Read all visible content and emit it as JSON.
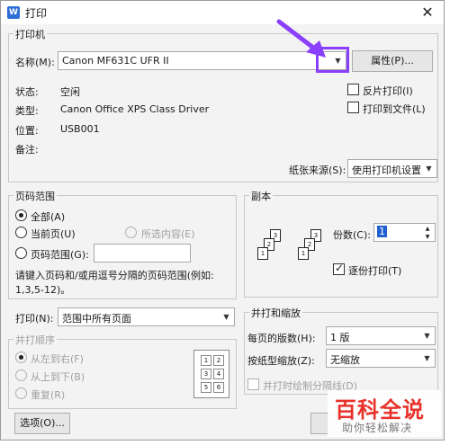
{
  "window": {
    "title": "打印",
    "close_glyph": "✕",
    "app_icon_glyph": "W"
  },
  "printer": {
    "group_label": "打印机",
    "name_label": "名称(M):",
    "name_value": "Canon MF631C UFR II",
    "properties_label": "属性(P)...",
    "status_label": "状态:",
    "status_value": "空闲",
    "type_label": "类型:",
    "type_value": "Canon Office XPS Class Driver",
    "location_label": "位置:",
    "location_value": "USB001",
    "comment_label": "备注:",
    "reverse_print_label": "反片打印(I)",
    "print_to_file_label": "打印到文件(L)",
    "paper_source_label": "纸张来源(S):",
    "paper_source_value": "使用打印机设置"
  },
  "page_range": {
    "group_label": "页码范围",
    "all_label": "全部(A)",
    "current_label": "当前页(U)",
    "selection_label": "所选内容(E)",
    "pages_label": "页码范围(G):",
    "hint_line1": "请键入页码和/或用逗号分隔的页码范围(例如:",
    "hint_line2": "1,3,5-12)。"
  },
  "copies": {
    "group_label": "副本",
    "count_label": "份数(C):",
    "count_value": "1",
    "collate_label": "逐份打印(T)"
  },
  "print_what": {
    "label": "打印(N):",
    "value": "范围中所有页面"
  },
  "order": {
    "group_label": "并打顺序",
    "left_to_right": "从左到右(F)",
    "top_to_bottom": "从上到下(B)",
    "repeat": "重复(R)",
    "preview_pages": [
      "1",
      "2",
      "3",
      "4",
      "5",
      "6"
    ]
  },
  "zoom": {
    "group_label": "并打和缩放",
    "pages_per_sheet_label": "每页的版数(H):",
    "pages_per_sheet_value": "1 版",
    "scale_label": "按纸型缩放(Z):",
    "scale_value": "无缩放",
    "draw_borders_label": "并打时绘制分隔线(D)"
  },
  "footer": {
    "options_label": "选项(O)..."
  },
  "watermark": {
    "line1": "百科全说",
    "line2": "助你轻松解决"
  },
  "colors": {
    "annotation": "#8a3ffc",
    "watermark_red": "#e8322b"
  }
}
